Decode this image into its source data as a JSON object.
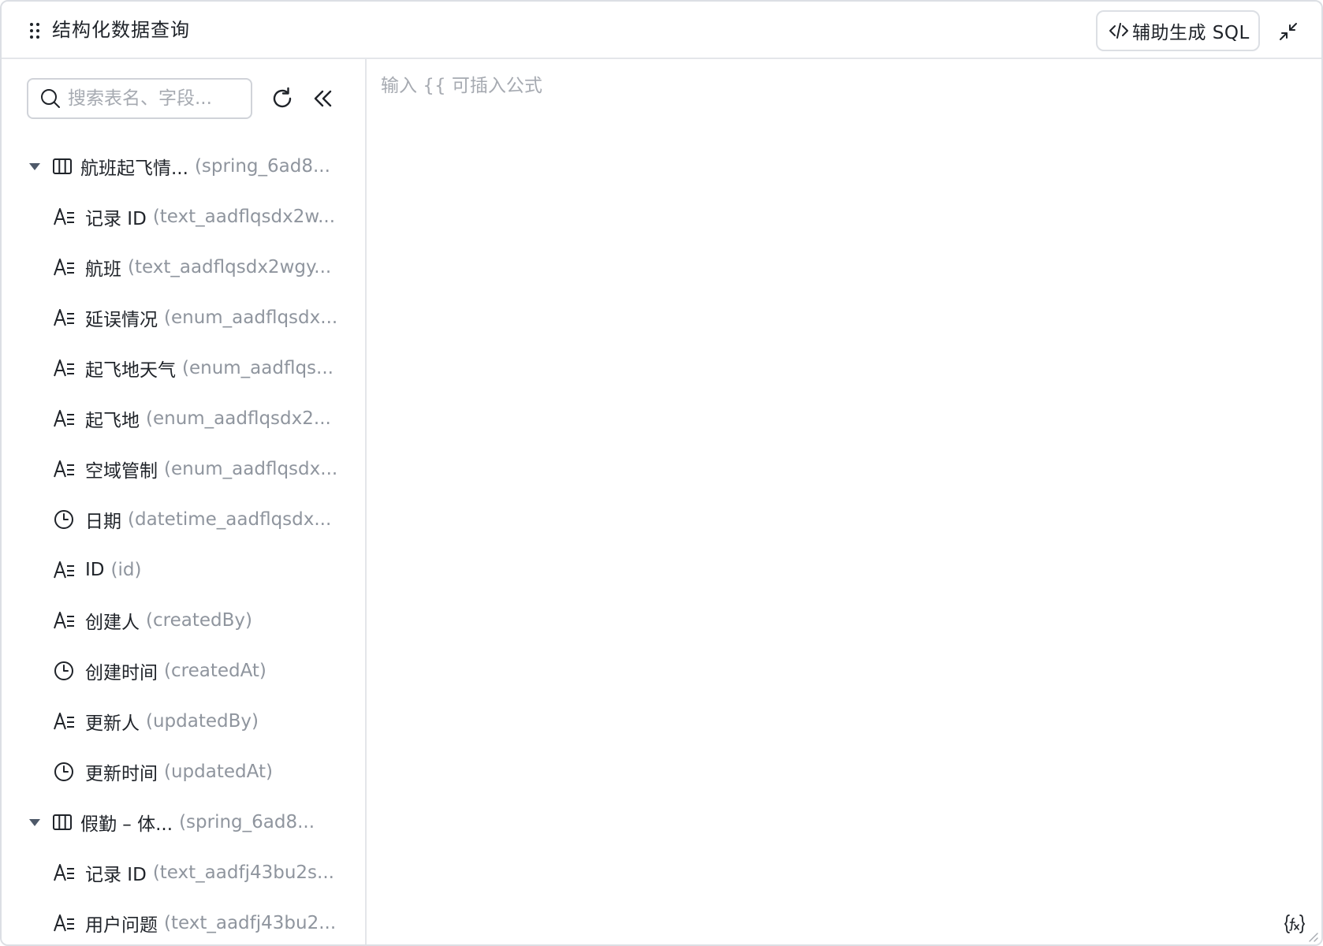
{
  "header": {
    "title": "结构化数据查询",
    "sql_button_label": "辅助生成 SQL"
  },
  "sidebar": {
    "search_placeholder": "搜索表名、字段..."
  },
  "tables": [
    {
      "name": "航班起飞情...",
      "api": "(spring_6ad8...",
      "expanded": true,
      "fields": [
        {
          "icon": "text-field-icon",
          "name": "记录 ID",
          "api": "(text_aadflqsdx2w..."
        },
        {
          "icon": "text-field-icon",
          "name": "航班",
          "api": "(text_aadflqsdx2wgy..."
        },
        {
          "icon": "text-field-icon",
          "name": "延误情况",
          "api": "(enum_aadflqsdx..."
        },
        {
          "icon": "text-field-icon",
          "name": "起飞地天气",
          "api": "(enum_aadflqs..."
        },
        {
          "icon": "text-field-icon",
          "name": "起飞地",
          "api": "(enum_aadflqsdx2..."
        },
        {
          "icon": "text-field-icon",
          "name": "空域管制",
          "api": "(enum_aadflqsdx..."
        },
        {
          "icon": "clock-icon",
          "name": "日期",
          "api": "(datetime_aadflqsdx..."
        },
        {
          "icon": "text-field-icon",
          "name": "ID",
          "api": "(id)"
        },
        {
          "icon": "text-field-icon",
          "name": "创建人",
          "api": "(createdBy)"
        },
        {
          "icon": "clock-icon",
          "name": "创建时间",
          "api": "(createdAt)"
        },
        {
          "icon": "text-field-icon",
          "name": "更新人",
          "api": "(updatedBy)"
        },
        {
          "icon": "clock-icon",
          "name": "更新时间",
          "api": "(updatedAt)"
        }
      ]
    },
    {
      "name": "假勤 – 体...",
      "api": "(spring_6ad8...",
      "expanded": true,
      "fields": [
        {
          "icon": "text-field-icon",
          "name": "记录 ID",
          "api": "(text_aadfj43bu2s..."
        },
        {
          "icon": "text-field-icon",
          "name": "用户问题",
          "api": "(text_aadfj43bu2..."
        }
      ]
    }
  ],
  "editor": {
    "placeholder": "输入 {{ 可插入公式"
  }
}
